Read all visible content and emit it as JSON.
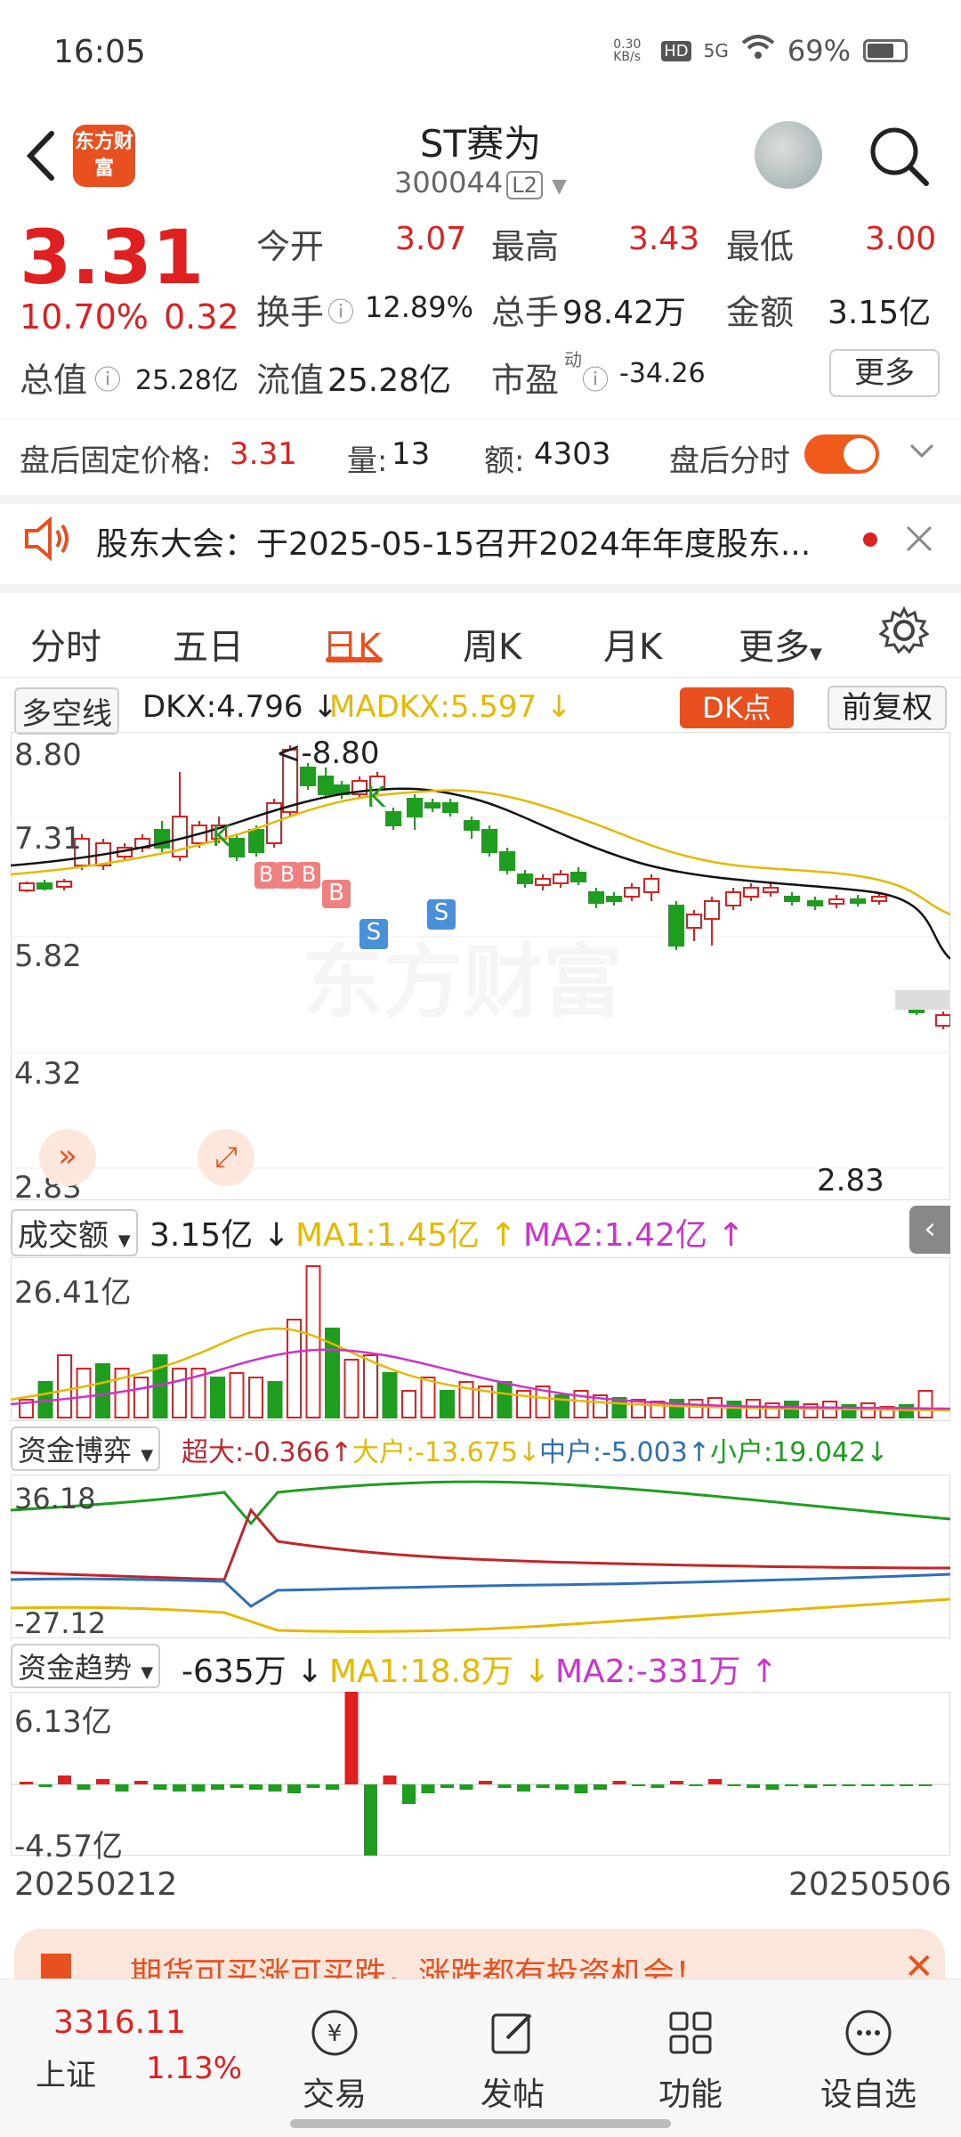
{
  "status_bar": {
    "time": "16:05",
    "net_speed": "0.30 KB/s",
    "hd": "HD",
    "network": "5G",
    "battery": "69%"
  },
  "header": {
    "logo_text": "东方财富",
    "title": "ST赛为",
    "code": "300044",
    "level": "L2"
  },
  "quote": {
    "price": "3.31",
    "change_pct": "10.70%",
    "change_amt": "0.32",
    "open_label": "今开",
    "open": "3.07",
    "high_label": "最高",
    "high": "3.43",
    "low_label": "最低",
    "low": "3.00",
    "turnover_label": "换手",
    "turnover": "12.89%",
    "volume_label": "总手",
    "volume": "98.42万",
    "amount_label": "金额",
    "amount": "3.15亿",
    "mktcap_label": "总值",
    "mktcap": "25.28亿",
    "float_label": "流值",
    "float_cap": "25.28亿",
    "pe_label": "市盈",
    "pe_sup": "动",
    "pe": "-34.26",
    "more": "更多"
  },
  "after_hours": {
    "price_label": "盘后固定价格:",
    "price": "3.31",
    "vol_label": "量:",
    "vol": "13",
    "amt_label": "额:",
    "amt": "4303",
    "timeshare_label": "盘后分时"
  },
  "notice": {
    "text": "股东大会：于2025-05-15召开2024年年度股东..."
  },
  "tabs": [
    "分时",
    "五日",
    "日K",
    "周K",
    "月K",
    "更多"
  ],
  "indicator": {
    "name": "多空线",
    "dkx": "DKX:4.796",
    "madkx": "MADKX:5.597",
    "dk_button": "DK点",
    "fq_button": "前复权"
  },
  "kline": {
    "y_ticks": [
      "8.80",
      "7.31",
      "5.82",
      "4.32",
      "2.83"
    ],
    "high_marker": "<-8.80",
    "low_marker": "2.83",
    "watermark": "东方财富",
    "k_markers": [
      "K",
      "K"
    ],
    "b_markers": [
      "B",
      "B",
      "B",
      "B"
    ],
    "s_markers": [
      "S",
      "S"
    ],
    "colors": {
      "up": "#e02020",
      "down": "#1f9d1f",
      "dkx": "#111111",
      "madkx": "#e6b800"
    }
  },
  "volume": {
    "name": "成交额",
    "value": "3.15亿",
    "ma1": "MA1:1.45亿",
    "ma2": "MA2:1.42亿",
    "y_top": "26.41亿"
  },
  "capital_game": {
    "name": "资金博弈",
    "super": "超大:-0.366",
    "large": "大户:-13.675",
    "medium": "中户:-5.003",
    "small": "小户:19.042",
    "y_top": "36.18",
    "y_bottom": "-27.12"
  },
  "capital_trend": {
    "name": "资金趋势",
    "value": "-635万",
    "ma1": "MA1:18.8万",
    "ma2": "MA2:-331万",
    "y_top": "6.13亿",
    "y_bottom": "-4.57亿"
  },
  "date_range": {
    "start": "20250212",
    "end": "20250506"
  },
  "banner": {
    "text": "期货可买涨可买跌，涨跌都有投资机会！"
  },
  "bottom_nav": {
    "index_value": "3316.11",
    "index_name": "上证",
    "index_change": "1.13%",
    "items": [
      "交易",
      "发帖",
      "功能",
      "设自选"
    ]
  }
}
